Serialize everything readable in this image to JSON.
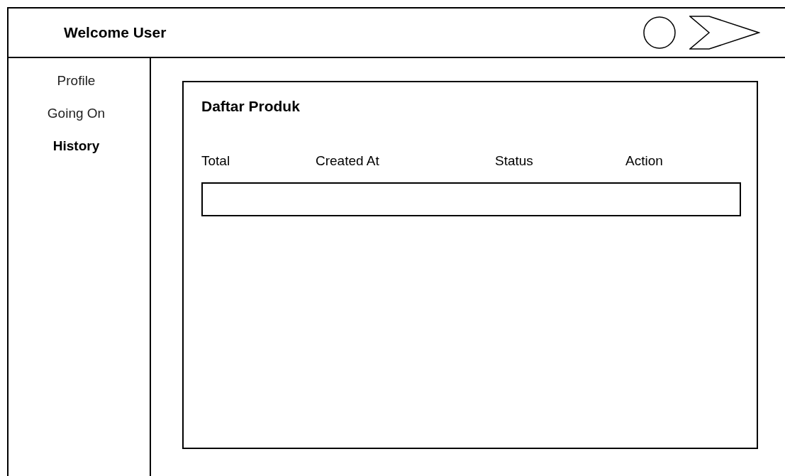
{
  "header": {
    "title": "Welcome User"
  },
  "sidebar": {
    "items": [
      {
        "label": "Profile",
        "selected": false
      },
      {
        "label": "Going On",
        "selected": false
      },
      {
        "label": "History",
        "selected": true
      }
    ]
  },
  "card": {
    "title": "Daftar Produk",
    "columns": [
      "Total",
      "Created At",
      "Status",
      "Action"
    ]
  }
}
